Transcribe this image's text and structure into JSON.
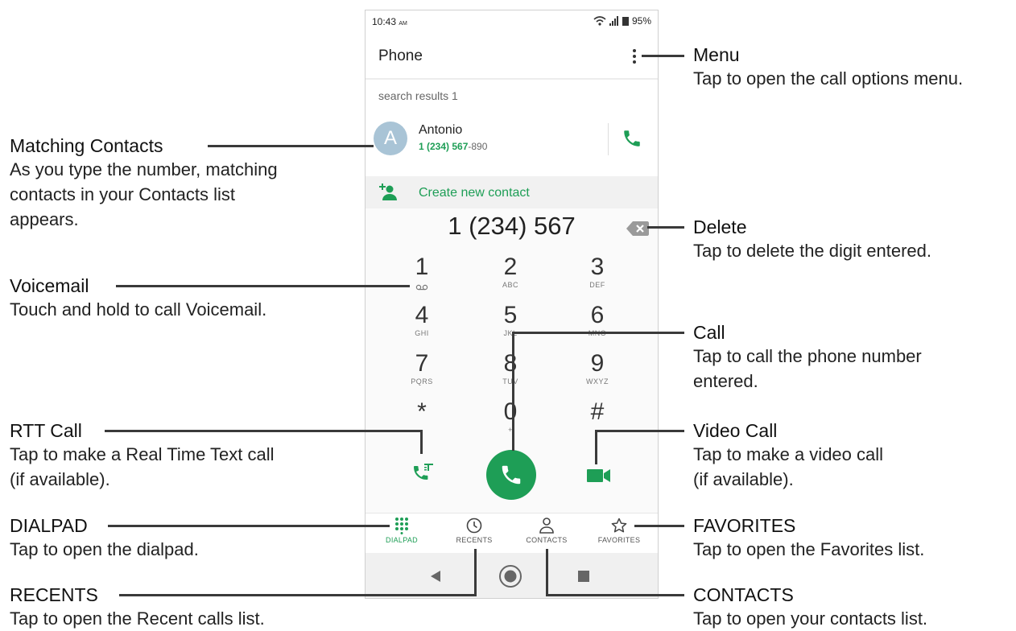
{
  "statusbar": {
    "time": "10:43",
    "ampm": "AM",
    "battery": "95%"
  },
  "appbar": {
    "title": "Phone"
  },
  "results": {
    "caption": "search results 1",
    "contact": {
      "initial": "A",
      "name": "Antonio",
      "number_match": "1 (234) 567",
      "number_rest": "-890"
    },
    "create_label": "Create new contact"
  },
  "dialer": {
    "digits": "1 (234) 567",
    "keys": [
      {
        "n": "1",
        "l": ""
      },
      {
        "n": "2",
        "l": "ABC"
      },
      {
        "n": "3",
        "l": "DEF"
      },
      {
        "n": "4",
        "l": "GHI"
      },
      {
        "n": "5",
        "l": "JKL"
      },
      {
        "n": "6",
        "l": "MNO"
      },
      {
        "n": "7",
        "l": "PQRS"
      },
      {
        "n": "8",
        "l": "TUV"
      },
      {
        "n": "9",
        "l": "WXYZ"
      },
      {
        "n": "*",
        "l": ""
      },
      {
        "n": "0",
        "l": "+"
      },
      {
        "n": "#",
        "l": ""
      }
    ]
  },
  "tabs": [
    {
      "label": "DIALPAD",
      "icon": "dialpad-icon"
    },
    {
      "label": "RECENTS",
      "icon": "clock-icon"
    },
    {
      "label": "CONTACTS",
      "icon": "person-icon"
    },
    {
      "label": "FAVORITES",
      "icon": "star-icon"
    }
  ],
  "colors": {
    "accent": "#1e9e56"
  },
  "annotations": {
    "menu": {
      "title": "Menu",
      "desc": "Tap to open the call options menu."
    },
    "matching": {
      "title": "Matching Contacts",
      "desc": "As you type the number, matching\ncontacts in your Contacts list\nappears."
    },
    "delete": {
      "title": "Delete",
      "desc": "Tap to delete the digit entered."
    },
    "voicemail": {
      "title": "Voicemail",
      "desc": "Touch and hold to call Voicemail."
    },
    "call": {
      "title": "Call",
      "desc": "Tap to call the phone number\nentered."
    },
    "rtt": {
      "title": "RTT Call",
      "desc": "Tap to make a Real Time Text call\n(if available)."
    },
    "video": {
      "title": "Video Call",
      "desc": "Tap to make a video call\n(if available)."
    },
    "dialpad": {
      "title": "DIALPAD",
      "desc": "Tap to open the dialpad."
    },
    "favorites": {
      "title": "FAVORITES",
      "desc": "Tap to open the Favorites list."
    },
    "recents": {
      "title": "RECENTS",
      "desc": "Tap to open the Recent calls list."
    },
    "contacts": {
      "title": "CONTACTS",
      "desc": "Tap to open your contacts list."
    }
  }
}
